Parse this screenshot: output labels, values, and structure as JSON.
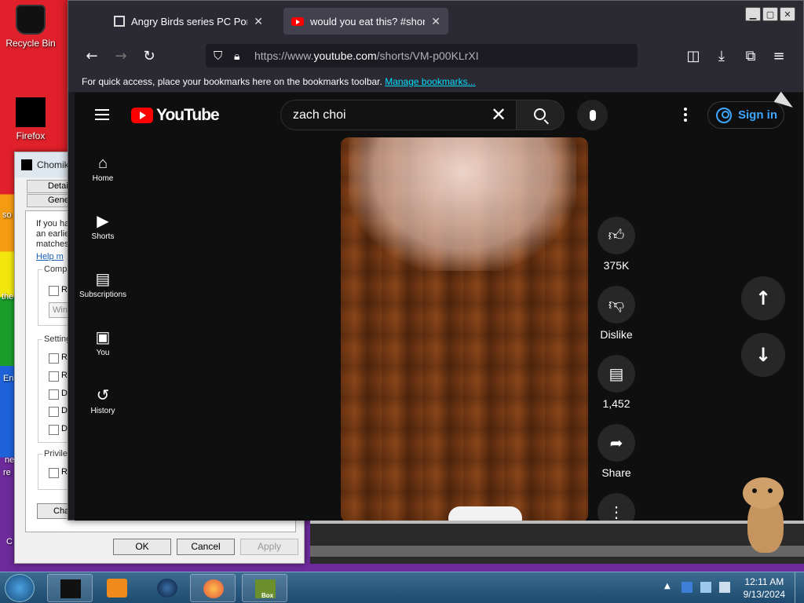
{
  "desktop": {
    "icons": [
      {
        "label": "Recycle Bin"
      },
      {
        "label": "Firefox"
      }
    ],
    "side_labels": [
      "so",
      "the",
      "En",
      "ne",
      "re",
      "C"
    ]
  },
  "dialog": {
    "title": "Chomik",
    "tabs": [
      "Details",
      "General"
    ],
    "text_lines": [
      "If you ha",
      "an earlie",
      "matches"
    ],
    "help_link": "Help m",
    "groups": {
      "compat": "Compa",
      "settings": "Setting",
      "privilege": "Privileg"
    },
    "select_value": "Win",
    "change_button": "Cha",
    "checkbox_labels": [
      "R",
      "R",
      "R",
      "D",
      "D",
      "D",
      "R"
    ],
    "buttons": {
      "ok": "OK",
      "cancel": "Cancel",
      "apply": "Apply"
    }
  },
  "browser": {
    "tabs": [
      {
        "label": "Angry Birds series PC Ports : Ro"
      },
      {
        "label": "would you eat this? #shorts - Y"
      }
    ],
    "url": {
      "prefix": "https://www.",
      "domain": "youtube.com",
      "path": "/shorts/VM-p00KLrXI"
    },
    "bookmarks_text": "For quick access, place your bookmarks here on the bookmarks toolbar.",
    "bookmarks_link": "Manage bookmarks..."
  },
  "youtube": {
    "logo_text": "YouTube",
    "search_value": "zach choi",
    "sign_in": "Sign in",
    "sidebar": [
      {
        "label": "Home",
        "icon": "home-icon"
      },
      {
        "label": "Shorts",
        "icon": "shorts-icon"
      },
      {
        "label": "Subscriptions",
        "icon": "subscriptions-icon"
      },
      {
        "label": "You",
        "icon": "you-icon"
      },
      {
        "label": "History",
        "icon": "history-icon"
      }
    ],
    "actions": {
      "like_count": "375K",
      "dislike": "Dislike",
      "comment_count": "1,452",
      "share": "Share"
    }
  },
  "taskbar": {
    "time": "12:11 AM",
    "date": "9/13/2024",
    "box_label": "Box"
  }
}
